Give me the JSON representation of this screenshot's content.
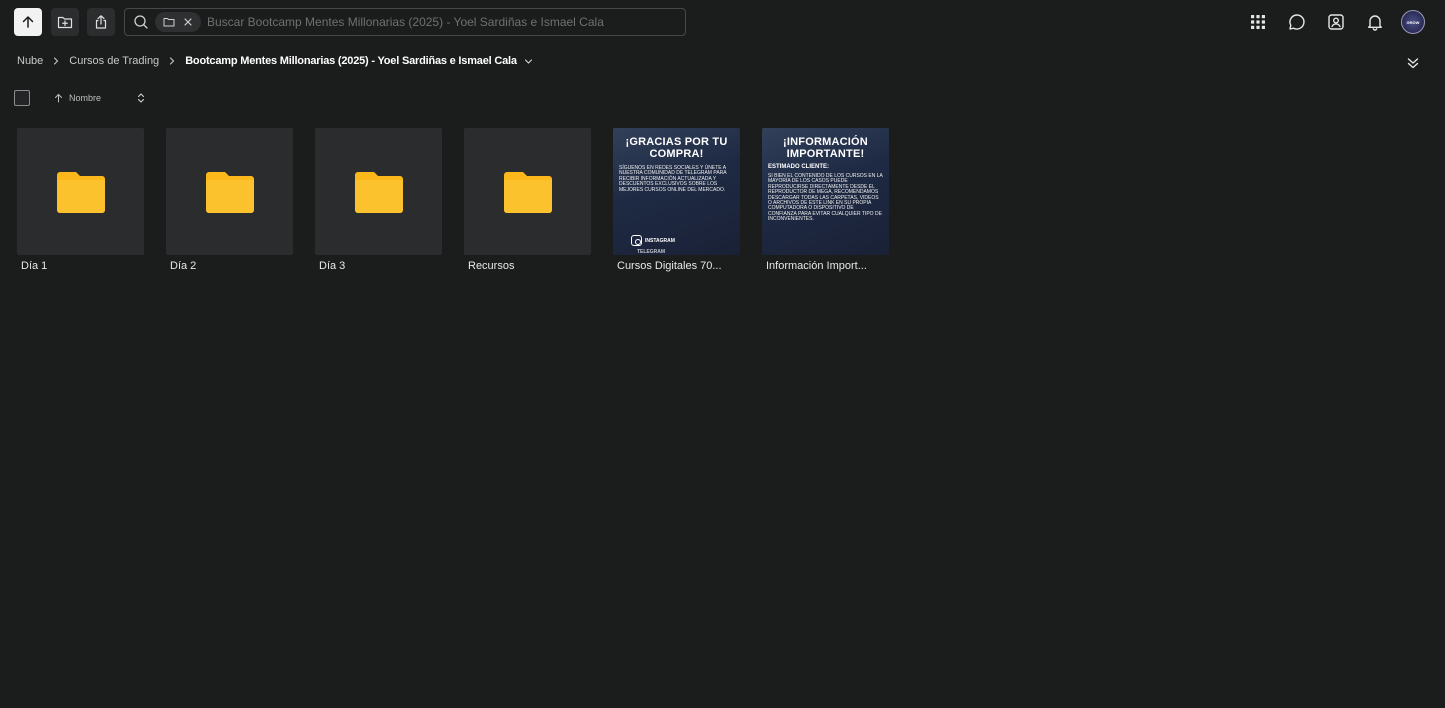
{
  "toolbar": {
    "search_placeholder": "Buscar Bootcamp Mentes Millonarias (2025) - Yoel Sardiñas e Ismael Cala",
    "avatar_label": "GROW"
  },
  "breadcrumb": {
    "items": [
      "Nube",
      "Cursos de Trading"
    ],
    "current": "Bootcamp Mentes Millonarias (2025) - Yoel Sardiñas e Ismael Cala"
  },
  "sort": {
    "label": "Nombre"
  },
  "files": [
    {
      "name": "Día 1",
      "type": "folder"
    },
    {
      "name": "Día 2",
      "type": "folder"
    },
    {
      "name": "Día 3",
      "type": "folder"
    },
    {
      "name": "Recursos",
      "type": "folder"
    },
    {
      "name": "Cursos Digitales 70...",
      "type": "image",
      "thumb": {
        "title": "¡GRACIAS POR TU COMPRA!",
        "body": "SÍGUENOS EN REDES SOCIALES Y ÚNETE A NUESTRA COMUNIDAD DE TELEGRAM PARA RECIBIR INFORMACIÓN ACTUALIZADA Y DESCUENTOS EXCLUSIVOS SOBRE LOS MEJORES CURSOS ONLINE DEL MERCADO.",
        "foot": "INSTAGRAM",
        "foot2": "TELEGRAM"
      }
    },
    {
      "name": "Información Import...",
      "type": "image",
      "thumb": {
        "title": "¡INFORMACIÓN IMPORTANTE!",
        "subtitle": "ESTIMADO CLIENTE:",
        "body": "SI BIEN EL CONTENIDO DE LOS CURSOS EN LA MAYORÍA DE LOS CASOS PUEDE REPRODUCIRSE DIRECTAMENTE DESDE EL REPRODUCTOR DE MEGA, RECOMENDAMOS DESCARGAR TODAS LAS CARPETAS, VIDEOS O ARCHIVOS DE ESTE LINK EN SU PROPIA COMPUTADORA O DISPOSITIVO DE CONFIANZA PARA EVITAR CUALQUIER TIPO DE INCONVENIENTES."
      }
    }
  ],
  "colors": {
    "folder": "#fbb81b",
    "background": "#1b1c1c",
    "tile": "#2b2c2d"
  }
}
